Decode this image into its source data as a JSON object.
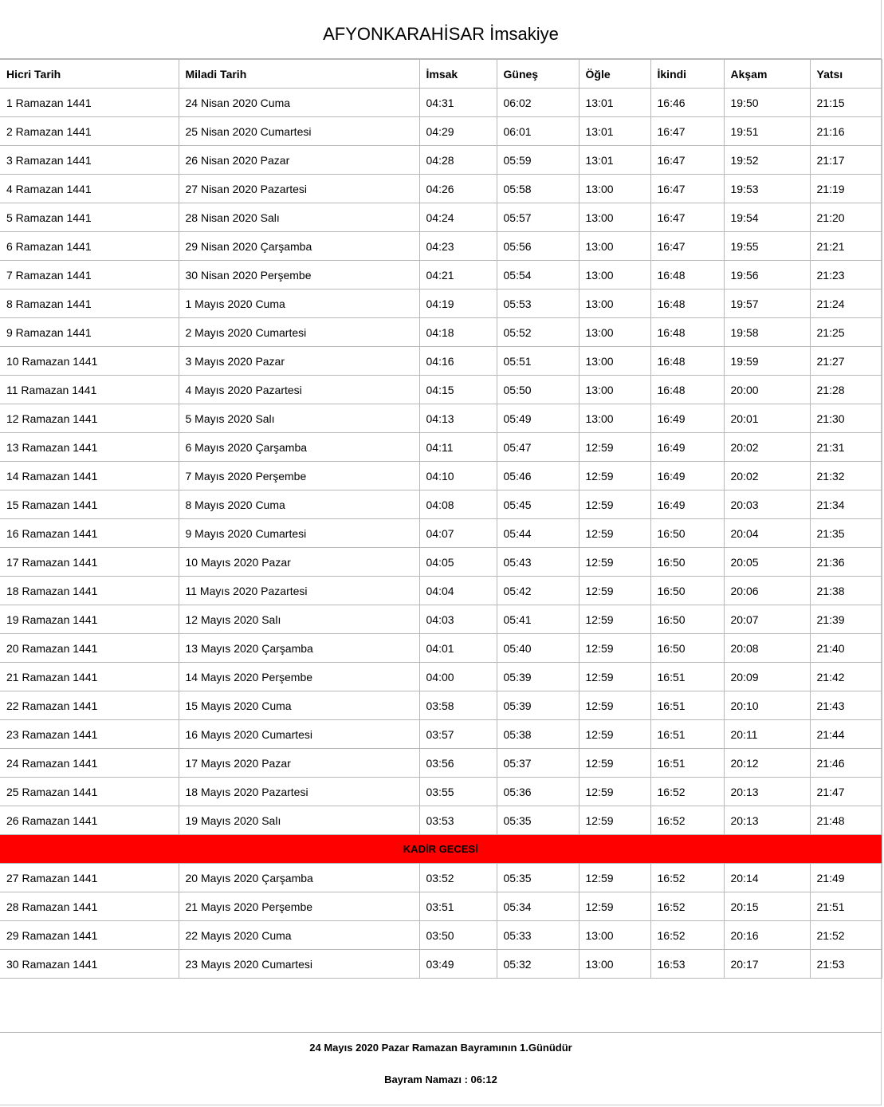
{
  "title": "AFYONKARAHİSAR İmsakiye",
  "table": {
    "headers": [
      "Hicri Tarih",
      "Miladi Tarih",
      "İmsak",
      "Güneş",
      "Öğle",
      "İkindi",
      "Akşam",
      "Yatsı"
    ],
    "rows": [
      [
        "1 Ramazan 1441",
        "24 Nisan 2020 Cuma",
        "04:31",
        "06:02",
        "13:01",
        "16:46",
        "19:50",
        "21:15"
      ],
      [
        "2 Ramazan 1441",
        "25 Nisan 2020 Cumartesi",
        "04:29",
        "06:01",
        "13:01",
        "16:47",
        "19:51",
        "21:16"
      ],
      [
        "3 Ramazan 1441",
        "26 Nisan 2020 Pazar",
        "04:28",
        "05:59",
        "13:01",
        "16:47",
        "19:52",
        "21:17"
      ],
      [
        "4 Ramazan 1441",
        "27 Nisan 2020 Pazartesi",
        "04:26",
        "05:58",
        "13:00",
        "16:47",
        "19:53",
        "21:19"
      ],
      [
        "5 Ramazan 1441",
        "28 Nisan 2020 Salı",
        "04:24",
        "05:57",
        "13:00",
        "16:47",
        "19:54",
        "21:20"
      ],
      [
        "6 Ramazan 1441",
        "29 Nisan 2020 Çarşamba",
        "04:23",
        "05:56",
        "13:00",
        "16:47",
        "19:55",
        "21:21"
      ],
      [
        "7 Ramazan 1441",
        "30 Nisan 2020 Perşembe",
        "04:21",
        "05:54",
        "13:00",
        "16:48",
        "19:56",
        "21:23"
      ],
      [
        "8 Ramazan 1441",
        "1 Mayıs 2020 Cuma",
        "04:19",
        "05:53",
        "13:00",
        "16:48",
        "19:57",
        "21:24"
      ],
      [
        "9 Ramazan 1441",
        "2 Mayıs 2020 Cumartesi",
        "04:18",
        "05:52",
        "13:00",
        "16:48",
        "19:58",
        "21:25"
      ],
      [
        "10 Ramazan 1441",
        "3 Mayıs 2020 Pazar",
        "04:16",
        "05:51",
        "13:00",
        "16:48",
        "19:59",
        "21:27"
      ],
      [
        "11 Ramazan 1441",
        "4 Mayıs 2020 Pazartesi",
        "04:15",
        "05:50",
        "13:00",
        "16:48",
        "20:00",
        "21:28"
      ],
      [
        "12 Ramazan 1441",
        "5 Mayıs 2020 Salı",
        "04:13",
        "05:49",
        "13:00",
        "16:49",
        "20:01",
        "21:30"
      ],
      [
        "13 Ramazan 1441",
        "6 Mayıs 2020 Çarşamba",
        "04:11",
        "05:47",
        "12:59",
        "16:49",
        "20:02",
        "21:31"
      ],
      [
        "14 Ramazan 1441",
        "7 Mayıs 2020 Perşembe",
        "04:10",
        "05:46",
        "12:59",
        "16:49",
        "20:02",
        "21:32"
      ],
      [
        "15 Ramazan 1441",
        "8 Mayıs 2020 Cuma",
        "04:08",
        "05:45",
        "12:59",
        "16:49",
        "20:03",
        "21:34"
      ],
      [
        "16 Ramazan 1441",
        "9 Mayıs 2020 Cumartesi",
        "04:07",
        "05:44",
        "12:59",
        "16:50",
        "20:04",
        "21:35"
      ],
      [
        "17 Ramazan 1441",
        "10 Mayıs 2020 Pazar",
        "04:05",
        "05:43",
        "12:59",
        "16:50",
        "20:05",
        "21:36"
      ],
      [
        "18 Ramazan 1441",
        "11 Mayıs 2020 Pazartesi",
        "04:04",
        "05:42",
        "12:59",
        "16:50",
        "20:06",
        "21:38"
      ],
      [
        "19 Ramazan 1441",
        "12 Mayıs 2020 Salı",
        "04:03",
        "05:41",
        "12:59",
        "16:50",
        "20:07",
        "21:39"
      ],
      [
        "20 Ramazan 1441",
        "13 Mayıs 2020 Çarşamba",
        "04:01",
        "05:40",
        "12:59",
        "16:50",
        "20:08",
        "21:40"
      ],
      [
        "21 Ramazan 1441",
        "14 Mayıs 2020 Perşembe",
        "04:00",
        "05:39",
        "12:59",
        "16:51",
        "20:09",
        "21:42"
      ],
      [
        "22 Ramazan 1441",
        "15 Mayıs 2020 Cuma",
        "03:58",
        "05:39",
        "12:59",
        "16:51",
        "20:10",
        "21:43"
      ],
      [
        "23 Ramazan 1441",
        "16 Mayıs 2020 Cumartesi",
        "03:57",
        "05:38",
        "12:59",
        "16:51",
        "20:11",
        "21:44"
      ],
      [
        "24 Ramazan 1441",
        "17 Mayıs 2020 Pazar",
        "03:56",
        "05:37",
        "12:59",
        "16:51",
        "20:12",
        "21:46"
      ],
      [
        "25 Ramazan 1441",
        "18 Mayıs 2020 Pazartesi",
        "03:55",
        "05:36",
        "12:59",
        "16:52",
        "20:13",
        "21:47"
      ],
      [
        "26 Ramazan 1441",
        "19 Mayıs 2020 Salı",
        "03:53",
        "05:35",
        "12:59",
        "16:52",
        "20:13",
        "21:48"
      ],
      [
        "KADİR GECESİ"
      ],
      [
        "27 Ramazan 1441",
        "20 Mayıs 2020 Çarşamba",
        "03:52",
        "05:35",
        "12:59",
        "16:52",
        "20:14",
        "21:49"
      ],
      [
        "28 Ramazan 1441",
        "21 Mayıs 2020 Perşembe",
        "03:51",
        "05:34",
        "12:59",
        "16:52",
        "20:15",
        "21:51"
      ],
      [
        "29 Ramazan 1441",
        "22 Mayıs 2020 Cuma",
        "03:50",
        "05:33",
        "13:00",
        "16:52",
        "20:16",
        "21:52"
      ],
      [
        "30 Ramazan 1441",
        "23 Mayıs 2020 Cumartesi",
        "03:49",
        "05:32",
        "13:00",
        "16:53",
        "20:17",
        "21:53"
      ]
    ],
    "highlight_color": "#ff0000"
  },
  "footer": {
    "bayram_note": "24 Mayıs 2020 Pazar Ramazan Bayramının 1.Günüdür",
    "bayram_namazi": "Bayram Namazı : 06:12"
  }
}
